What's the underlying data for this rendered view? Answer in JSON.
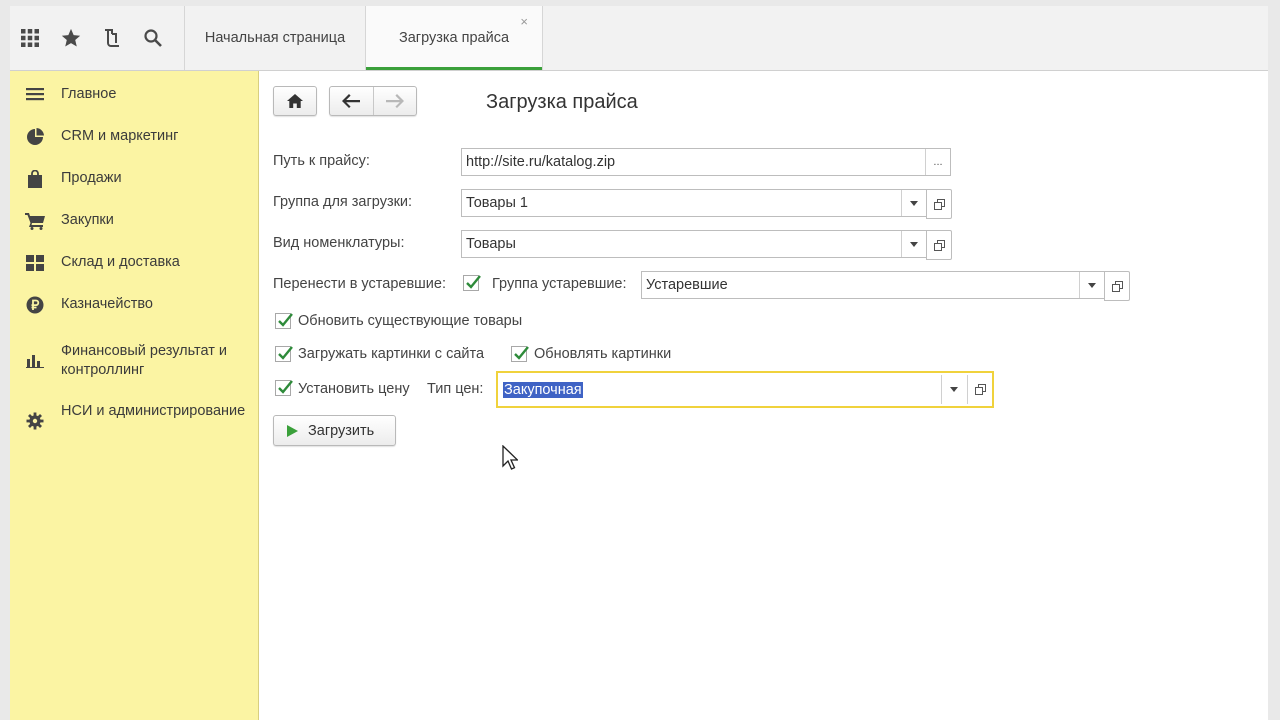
{
  "tabs": {
    "home_label": "Начальная страница",
    "active_label": "Загрузка прайса",
    "close_glyph": "×"
  },
  "toolbar": {
    "icons": [
      "apps-grid-icon",
      "star-icon",
      "history-icon",
      "search-icon"
    ]
  },
  "sidebar": {
    "items": [
      {
        "label": "Главное",
        "icon": "menu-icon"
      },
      {
        "label": "CRM и маркетинг",
        "icon": "pie-chart-icon"
      },
      {
        "label": "Продажи",
        "icon": "shopping-bag-icon"
      },
      {
        "label": "Закупки",
        "icon": "cart-icon"
      },
      {
        "label": "Склад и доставка",
        "icon": "warehouse-grid-icon"
      },
      {
        "label": "Казначейство",
        "icon": "ruble-coin-icon"
      },
      {
        "label": "Финансовый результат и контроллинг",
        "icon": "bar-chart-icon"
      },
      {
        "label": "НСИ и администрирование",
        "icon": "gear-icon"
      }
    ]
  },
  "form": {
    "title": "Загрузка прайса",
    "price_path": {
      "label": "Путь к прайсу:",
      "value": "http://site.ru/katalog.zip",
      "picker_label": "..."
    },
    "upload_group": {
      "label": "Группа для загрузки:",
      "value": "Товары 1"
    },
    "nomenclature_type": {
      "label": "Вид номенклатуры:",
      "value": "Товары"
    },
    "move_obsolete": {
      "label": "Перенести в устаревшие:",
      "checked": true
    },
    "obsolete_group": {
      "label": "Группа устаревшие:",
      "value": "Устаревшие"
    },
    "update_existing": {
      "label": "Обновить существующие товары",
      "checked": true
    },
    "load_images": {
      "label": "Загружать картинки с сайта",
      "checked": true
    },
    "update_images": {
      "label": "Обновлять картинки",
      "checked": true
    },
    "set_price": {
      "label": "Установить цену",
      "checked": true
    },
    "price_type": {
      "label": "Тип цен:",
      "value": "Закупочная"
    },
    "load_button": "Загрузить"
  },
  "colors": {
    "sidebar_bg": "#fbf4a3",
    "active_tab_accent": "#3aa03a",
    "focus_border": "#f0d23c",
    "check_mark": "#2e8b3a",
    "selection": "#3f63c5"
  }
}
